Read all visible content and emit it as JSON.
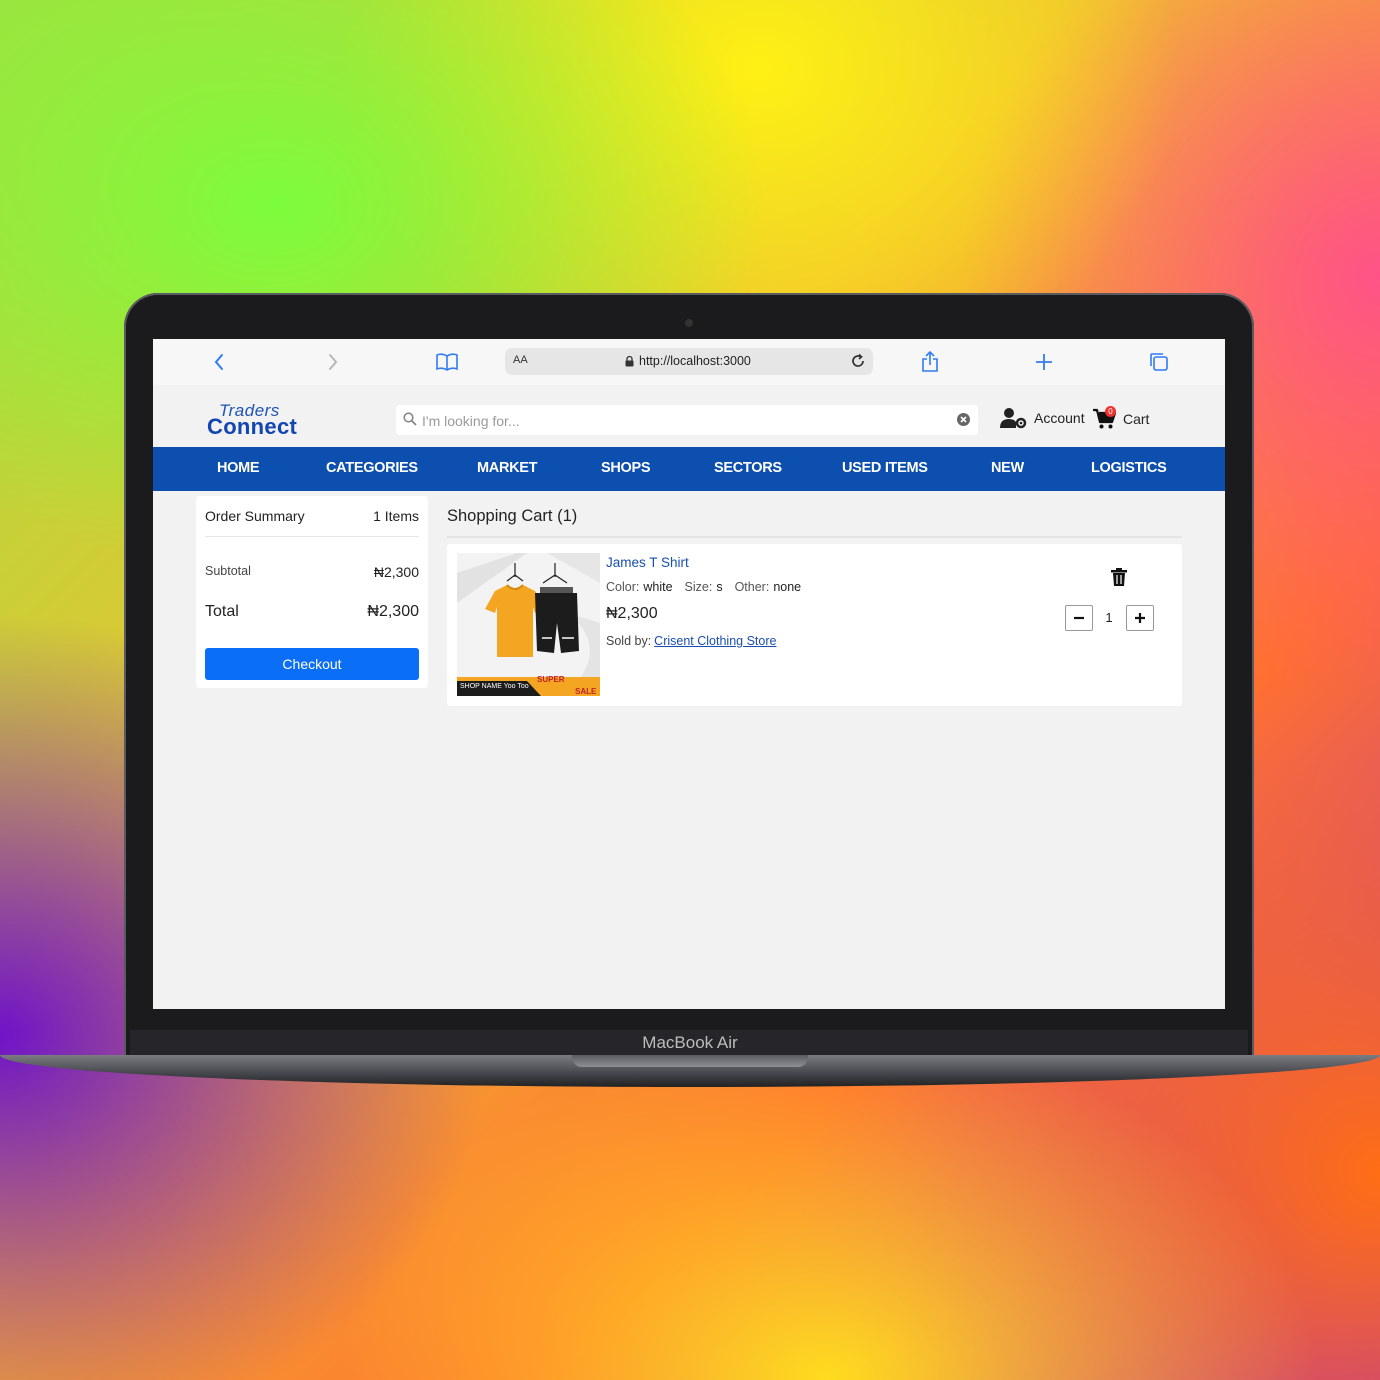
{
  "device": {
    "label": "MacBook Air"
  },
  "browser": {
    "aa_label": "AA",
    "url": "http://localhost:3000"
  },
  "site": {
    "logo": {
      "top": "Traders",
      "bottom": "Connect"
    },
    "search": {
      "placeholder": "I'm looking for..."
    },
    "account_label": "Account",
    "cart_label": "Cart",
    "cart_count": "0",
    "nav": [
      "HOME",
      "CATEGORIES",
      "MARKET",
      "SHOPS",
      "SECTORS",
      "USED ITEMS",
      "NEW",
      "LOGISTICS"
    ]
  },
  "summary": {
    "title": "Order Summary",
    "items_count": "1 Items",
    "subtotal_label": "Subtotal",
    "subtotal_value": "₦2,300",
    "total_label": "Total",
    "total_value": "₦2,300",
    "checkout_label": "Checkout"
  },
  "cart": {
    "title": "Shopping Cart (1)",
    "item": {
      "name": "James T Shirt",
      "color_label": "Color:",
      "color_value": "white",
      "size_label": "Size:",
      "size_value": "s",
      "other_label": "Other:",
      "other_value": "none",
      "price": "₦2,300",
      "sold_by_label": "Sold by:",
      "seller": "Crisent Clothing Store",
      "quantity": "1",
      "image_caption": "SHOP NAME Yoo Too",
      "image_badge_1": "SUPER",
      "image_badge_2": "SALE"
    }
  },
  "colors": {
    "nav_blue": "#0d4fae",
    "checkout_blue": "#0b6ef6",
    "link_blue": "#1a4fae"
  }
}
